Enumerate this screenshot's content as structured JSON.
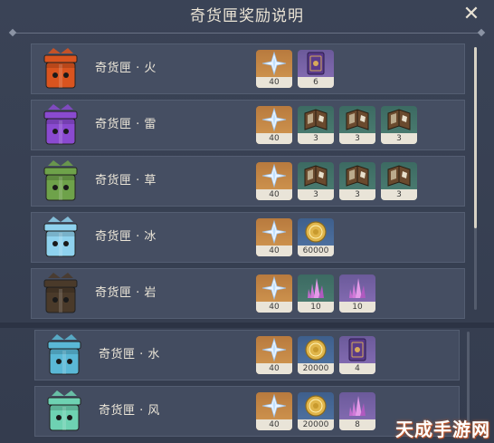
{
  "title": "奇货匣奖励说明",
  "close_icon": "close-icon",
  "watermark": "天成手游网",
  "rows": [
    {
      "label": "奇货匣 · 火",
      "box_color": "#d9541f",
      "rewards": [
        {
          "icon": "primogem-star-icon",
          "count": "40",
          "bg": "orange"
        },
        {
          "icon": "purple-book-icon",
          "count": "6",
          "bg": "purple"
        }
      ]
    },
    {
      "label": "奇货匣 · 雷",
      "box_color": "#8a4ad0",
      "rewards": [
        {
          "icon": "primogem-star-icon",
          "count": "40",
          "bg": "orange"
        },
        {
          "icon": "talent-book-icon",
          "count": "3",
          "bg": "green"
        },
        {
          "icon": "talent-book-icon",
          "count": "3",
          "bg": "green"
        },
        {
          "icon": "talent-book-icon",
          "count": "3",
          "bg": "green"
        }
      ]
    },
    {
      "label": "奇货匣 · 草",
      "box_color": "#6ea24a",
      "rewards": [
        {
          "icon": "primogem-star-icon",
          "count": "40",
          "bg": "orange"
        },
        {
          "icon": "talent-book-icon",
          "count": "3",
          "bg": "green"
        },
        {
          "icon": "talent-book-icon",
          "count": "3",
          "bg": "green"
        },
        {
          "icon": "talent-book-icon",
          "count": "3",
          "bg": "green"
        }
      ]
    },
    {
      "label": "奇货匣 · 冰",
      "box_color": "#8fd2ee",
      "rewards": [
        {
          "icon": "primogem-star-icon",
          "count": "40",
          "bg": "orange"
        },
        {
          "icon": "mora-coin-icon",
          "count": "60000",
          "bg": "blue"
        }
      ]
    },
    {
      "label": "奇货匣 · 岩",
      "box_color": "#4a3a2a",
      "rewards": [
        {
          "icon": "primogem-star-icon",
          "count": "40",
          "bg": "orange"
        },
        {
          "icon": "crystal-icon",
          "count": "10",
          "bg": "green"
        },
        {
          "icon": "crystal-icon",
          "count": "10",
          "bg": "purple"
        }
      ]
    },
    {
      "label": "奇货匣 · 水",
      "box_color": "#5ab8d6",
      "rewards": [
        {
          "icon": "primogem-star-icon",
          "count": "40",
          "bg": "orange"
        },
        {
          "icon": "mora-coin-icon",
          "count": "20000",
          "bg": "blue"
        },
        {
          "icon": "purple-book-icon",
          "count": "4",
          "bg": "purple"
        }
      ]
    },
    {
      "label": "奇货匣 · 风",
      "box_color": "#6ed2b2",
      "rewards": [
        {
          "icon": "primogem-star-icon",
          "count": "40",
          "bg": "orange"
        },
        {
          "icon": "mora-coin-icon",
          "count": "20000",
          "bg": "blue"
        },
        {
          "icon": "crystal-icon",
          "count": "8",
          "bg": "purple"
        }
      ]
    }
  ]
}
